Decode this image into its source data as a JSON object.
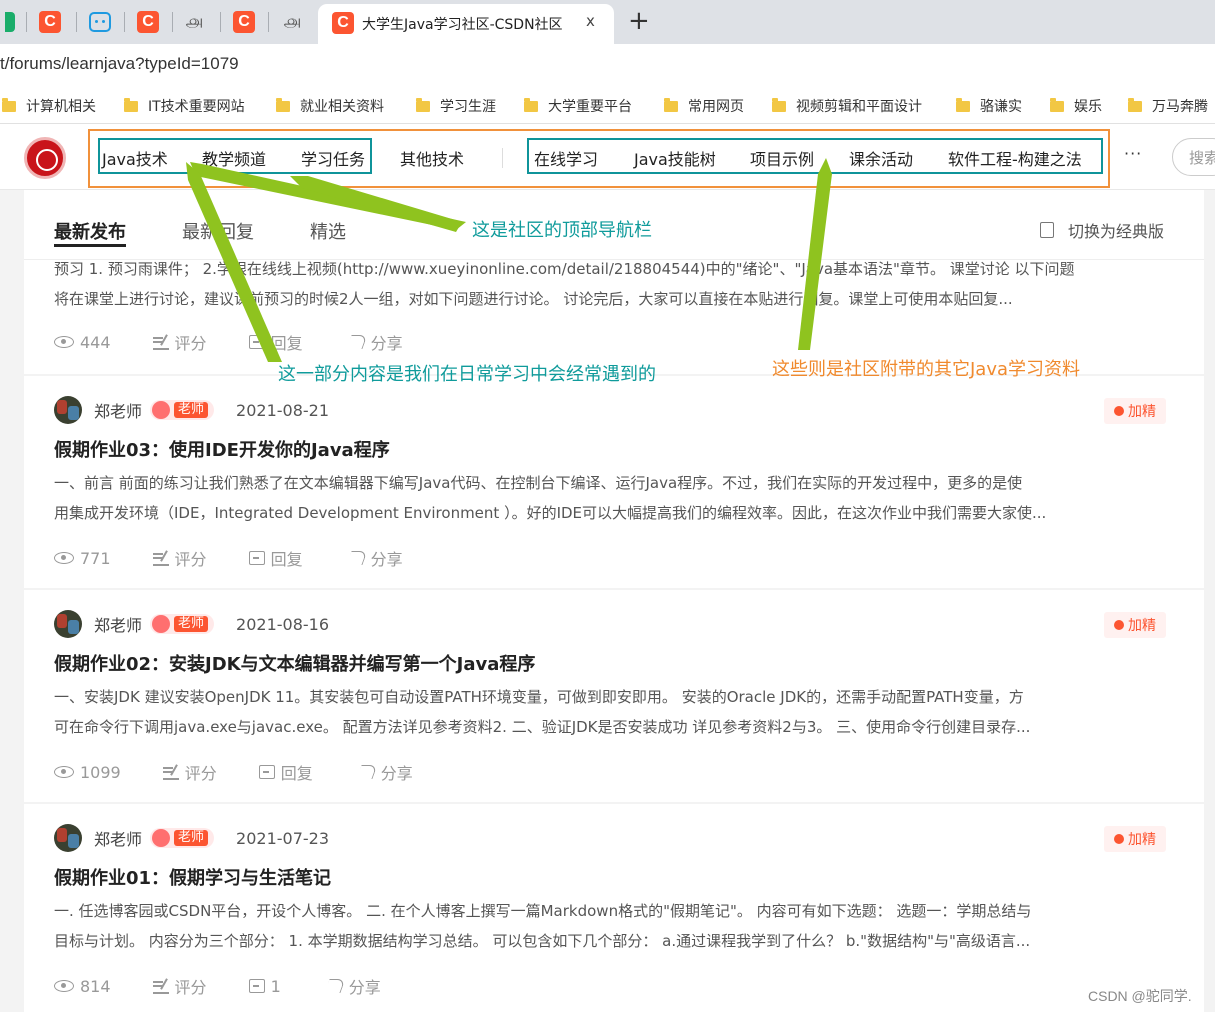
{
  "browser": {
    "active_tab_title": "大学生Java学习社区-CSDN社区",
    "close_glyph": "x",
    "new_tab_glyph": "+",
    "address": "t/forums/learnjava?typeId=1079",
    "bookmarks": [
      "计算机相关",
      "IT技术重要网站",
      "就业相关资料",
      "学习生涯",
      "大学重要平台",
      "常用网页",
      "视频剪辑和平面设计",
      "骆谦实",
      "娱乐",
      "万马奔腾"
    ]
  },
  "nav": {
    "items": [
      "Java技术",
      "教学频道",
      "学习任务",
      "其他技术",
      "在线学习",
      "Java技能树",
      "项目示例",
      "课余活动",
      "软件工程-构建之法"
    ],
    "more": "···",
    "search_placeholder": "搜索"
  },
  "sortbar": {
    "tabs": [
      "最新发布",
      "最新回复",
      "精选"
    ],
    "switch_label": "切换为经典版"
  },
  "first_post": {
    "excerpt_lines": [
      "预习 1. 预习雨课件； 2.学银在线线上视频(http://www.xueyinonline.com/detail/218804544)中的\"绪论\"、\"Java基本语法\"章节。 课堂讨论 以下问题",
      "将在课堂上进行讨论，建议课前预习的时候2人一组，对如下问题进行讨论。 讨论完后，大家可以直接在本贴进行回复。课堂上可使用本贴回复..."
    ],
    "views": "444",
    "rate": "评分",
    "reply": "回复",
    "share": "分享"
  },
  "posts": [
    {
      "author": "郑老师",
      "badge": "老师",
      "date": "2021-08-21",
      "tag": "加精",
      "title": "假期作业03：使用IDE开发你的Java程序",
      "excerpt_lines": [
        "一、前言 前面的练习让我们熟悉了在文本编辑器下编写Java代码、在控制台下编译、运行Java程序。不过，我们在实际的开发过程中，更多的是使",
        "用集成开发环境（IDE，Integrated Development Environment ）。好的IDE可以大幅提高我们的编程效率。因此，在这次作业中我们需要大家使..."
      ],
      "views": "771",
      "rate": "评分",
      "reply": "回复",
      "share": "分享"
    },
    {
      "author": "郑老师",
      "badge": "老师",
      "date": "2021-08-16",
      "tag": "加精",
      "title": "假期作业02：安装JDK与文本编辑器并编写第一个Java程序",
      "excerpt_lines": [
        "一、安装JDK 建议安装OpenJDK 11。其安装包可自动设置PATH环境变量，可做到即安即用。 安装的Oracle JDK的，还需手动配置PATH变量，方",
        "可在命令行下调用java.exe与javac.exe。 配置方法详见参考资料2. 二、验证JDK是否安装成功 详见参考资料2与3。 三、使用命令行创建目录存..."
      ],
      "views": "1099",
      "rate": "评分",
      "reply": "回复",
      "share": "分享"
    },
    {
      "author": "郑老师",
      "badge": "老师",
      "date": "2021-07-23",
      "tag": "加精",
      "title": "假期作业01：假期学习与生活笔记",
      "excerpt_lines": [
        "一. 任选博客园或CSDN平台，开设个人博客。 二. 在个人博客上撰写一篇Markdown格式的\"假期笔记\"。 内容可有如下选题： 选题一：学期总结与",
        "目标与计划。 内容分为三个部分： 1. 本学期数据结构学习总结。 可以包含如下几个部分： a.通过课程我学到了什么？ b.\"数据结构\"与\"高级语言..."
      ],
      "views": "814",
      "rate": "评分",
      "reply": "1",
      "share": "分享"
    }
  ],
  "annotations": {
    "top_nav": "这是社区的顶部导航栏",
    "daily": "这一部分内容是我们在日常学习中会经常遇到的",
    "extra": "这些则是社区附带的其它Java学习资料"
  },
  "watermark": "CSDN @驼同学.",
  "colors": {
    "csdn_red": "#fc5531",
    "teal": "#0f949a",
    "orange": "#f1913b",
    "arrow_green": "#8fc31f"
  }
}
